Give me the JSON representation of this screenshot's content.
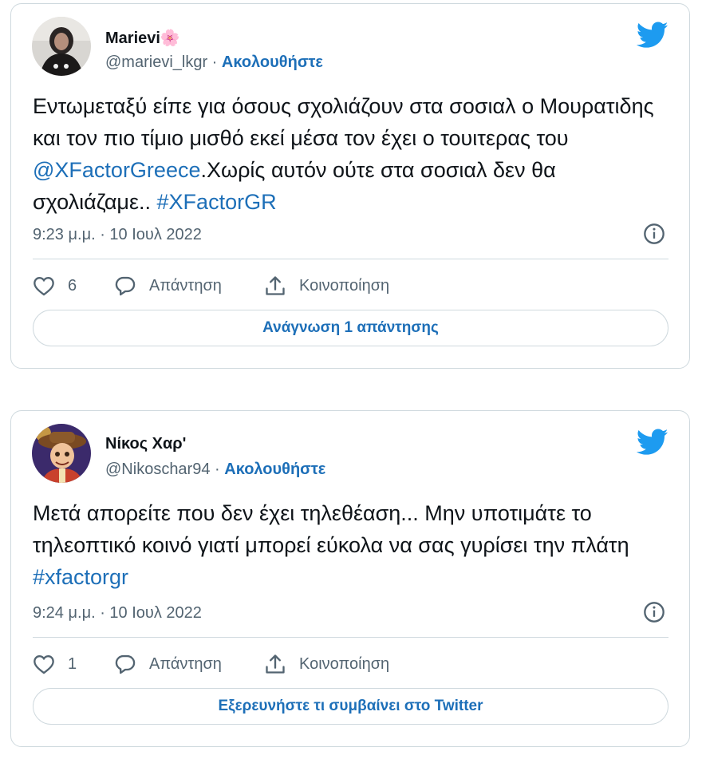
{
  "colors": {
    "link": "#1d6fb8",
    "muted": "#536471",
    "border": "#cfd9de",
    "twitter_blue": "#1d9bf0"
  },
  "tweets": [
    {
      "name": "Marievi🌸",
      "handle": "@marievi_lkgr",
      "separator": "·",
      "follow_label": "Ακολουθήστε",
      "text_parts": {
        "p1": "Εντωμεταξύ είπε για όσους σχολιάζουν στα σοσιαλ ο Μουρατιδης και τον πιο τίμιο μισθό εκεί μέσα τον έχει ο τουιτερας του ",
        "mention": "@XFactorGreece",
        "p2": ".Χωρίς αυτόν ούτε στα σοσιαλ δεν θα σχολιάζαμε.. ",
        "hashtag": "#XFactorGR"
      },
      "timestamp": "9:23 μ.μ. · 10 Ιουλ 2022",
      "like_count": "6",
      "reply_label": "Απάντηση",
      "share_label": "Κοινοποίηση",
      "cta_label": "Ανάγνωση 1 απάντησης",
      "icons": {
        "avatar": "avatar-photo",
        "logo": "twitter-bird-icon",
        "info": "info-icon",
        "like": "heart-icon",
        "reply": "speech-bubble-icon",
        "share": "share-icon"
      }
    },
    {
      "name": "Νίκος Χαρ'",
      "handle": "@Nikoschar94",
      "separator": "·",
      "follow_label": "Ακολουθήστε",
      "text_parts": {
        "p1": "Μετά απορείτε που δεν έχει τηλεθέαση... Μην υποτιμάτε το τηλεοπτικό κοινό γιατί μπορεί εύκολα να σας γυρίσει την πλάτη ",
        "hashtag": "#xfactorgr"
      },
      "timestamp": "9:24 μ.μ. · 10 Ιουλ 2022",
      "like_count": "1",
      "reply_label": "Απάντηση",
      "share_label": "Κοινοποίηση",
      "cta_label": "Εξερευνήστε τι συμβαίνει στο Twitter",
      "icons": {
        "avatar": "avatar-cartoon",
        "logo": "twitter-bird-icon",
        "info": "info-icon",
        "like": "heart-icon",
        "reply": "speech-bubble-icon",
        "share": "share-icon"
      }
    }
  ]
}
